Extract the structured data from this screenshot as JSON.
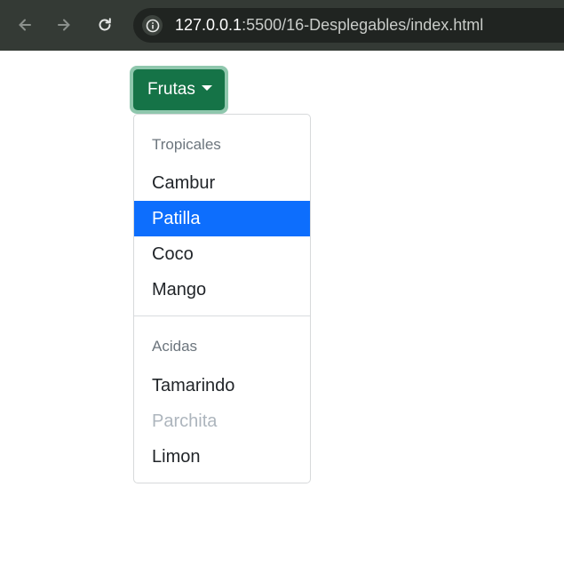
{
  "browser": {
    "url_host": "127.0.0.1",
    "url_path": ":5500/16-Desplegables/index.html"
  },
  "dropdown": {
    "button_label": "Frutas",
    "groups": [
      {
        "header": "Tropicales",
        "items": [
          {
            "label": "Cambur",
            "state": "normal"
          },
          {
            "label": "Patilla",
            "state": "active"
          },
          {
            "label": "Coco",
            "state": "normal"
          },
          {
            "label": "Mango",
            "state": "normal"
          }
        ]
      },
      {
        "header": "Acidas",
        "items": [
          {
            "label": "Tamarindo",
            "state": "normal"
          },
          {
            "label": "Parchita",
            "state": "disabled"
          },
          {
            "label": "Limon",
            "state": "normal"
          }
        ]
      }
    ]
  },
  "colors": {
    "button_bg": "#157347",
    "focus_ring": "#8fc7ad",
    "active_item_bg": "#0d6efd",
    "disabled_text": "#adb5bd"
  }
}
